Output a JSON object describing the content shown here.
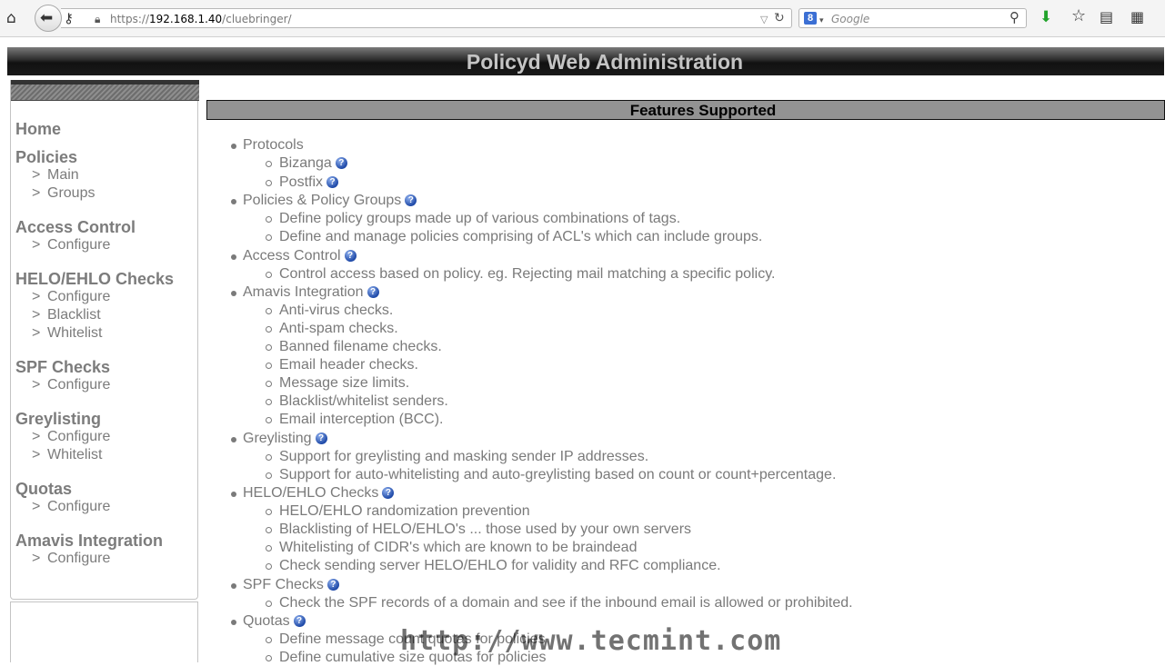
{
  "browser": {
    "url_prefix": "https://",
    "url_host": "192.168.1.40",
    "url_path": "/cluebringer/",
    "search_placeholder": "Google",
    "search_engine_letter": "8",
    "icons": [
      "home-icon",
      "back-arrow-icon",
      "key-icon",
      "lock-icon",
      "dropdown-icon",
      "reload-icon",
      "google-icon",
      "search-icon",
      "download-icon",
      "star-icon",
      "bookmarks-icon",
      "grid-icon"
    ]
  },
  "header": {
    "title": "Policyd Web Administration"
  },
  "sidebar": {
    "arrow": ">",
    "groups": [
      {
        "title": "Home",
        "items": []
      },
      {
        "title": "Policies",
        "items": [
          "Main",
          "Groups"
        ]
      },
      {
        "title": "Access Control",
        "items": [
          "Configure"
        ]
      },
      {
        "title": "HELO/EHLO Checks",
        "items": [
          "Configure",
          "Blacklist",
          "Whitelist"
        ]
      },
      {
        "title": "SPF Checks",
        "items": [
          "Configure"
        ]
      },
      {
        "title": "Greylisting",
        "items": [
          "Configure",
          "Whitelist"
        ]
      },
      {
        "title": "Quotas",
        "items": [
          "Configure"
        ]
      },
      {
        "title": "Amavis Integration",
        "items": [
          "Configure"
        ]
      }
    ]
  },
  "content": {
    "title": "Features Supported",
    "help_glyph": "?",
    "features": [
      {
        "label": "Protocols",
        "items": [
          "Bizanga",
          "Postfix"
        ]
      },
      {
        "label": "Policies & Policy Groups",
        "items": [
          "Define policy groups made up of various combinations of tags.",
          "Define and manage policies comprising of ACL's which can include groups."
        ]
      },
      {
        "label": "Access Control",
        "items": [
          "Control access based on policy. eg. Rejecting mail matching a specific policy."
        ]
      },
      {
        "label": "Amavis Integration",
        "items": [
          "Anti-virus checks.",
          "Anti-spam checks.",
          "Banned filename checks.",
          "Email header checks.",
          "Message size limits.",
          "Blacklist/whitelist senders.",
          "Email interception (BCC)."
        ]
      },
      {
        "label": "Greylisting",
        "items": [
          "Support for greylisting and masking sender IP addresses.",
          "Support for auto-whitelisting and auto-greylisting based on count or count+percentage."
        ]
      },
      {
        "label": "HELO/EHLO Checks",
        "items": [
          "HELO/EHLO randomization prevention",
          "Blacklisting of HELO/EHLO's ... those used by your own servers",
          "Whitelisting of CIDR's which are known to be braindead",
          "Check sending server HELO/EHLO for validity and RFC compliance."
        ]
      },
      {
        "label": "SPF Checks",
        "items": [
          "Check the SPF records of a domain and see if the inbound email is allowed or prohibited."
        ]
      },
      {
        "label": "Quotas",
        "items": [
          "Define message count quotas for policies",
          "Define cumulative size quotas for policies"
        ]
      }
    ]
  },
  "watermark": "http://www.tecmint.com"
}
